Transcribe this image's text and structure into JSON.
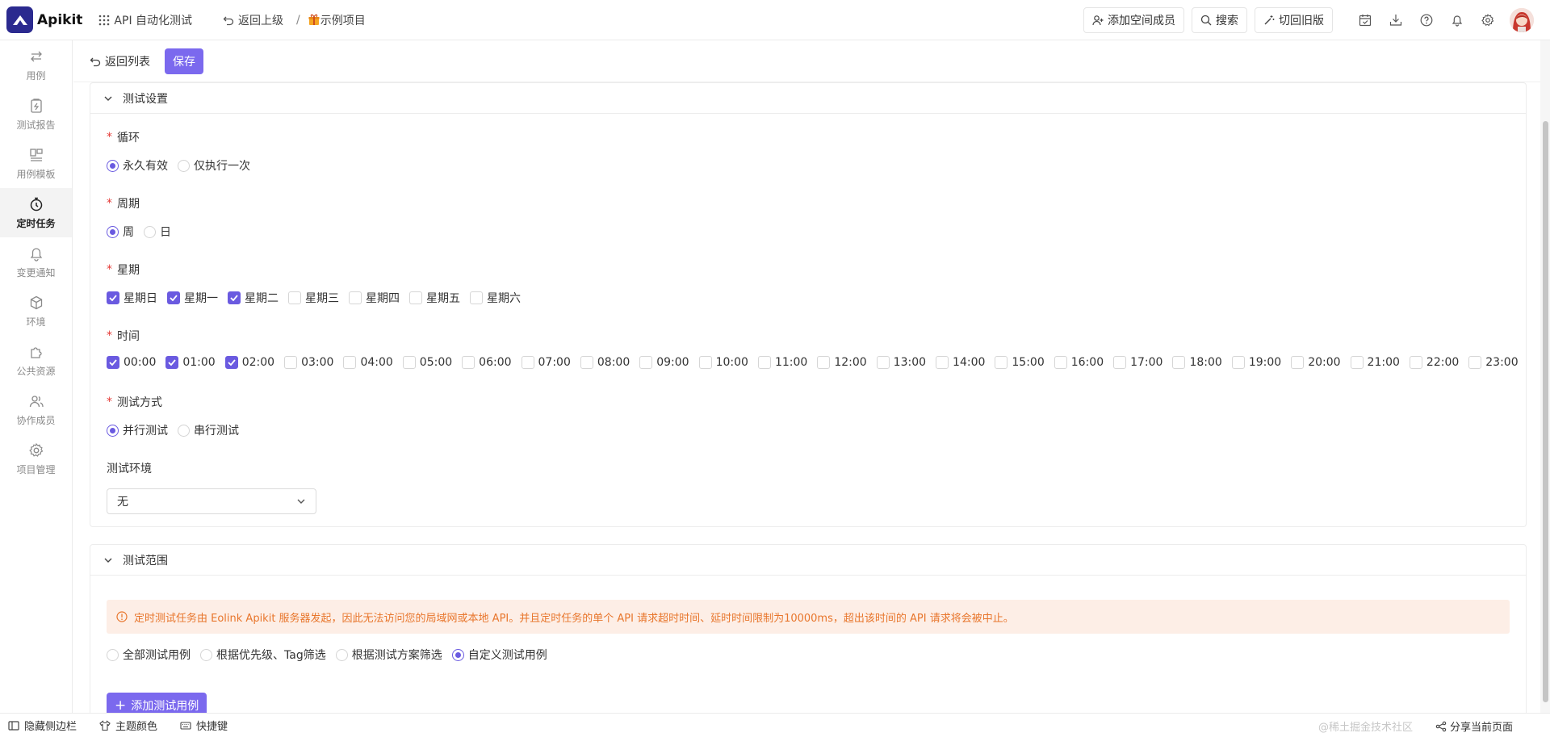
{
  "app": {
    "name": "Apikit"
  },
  "header": {
    "workspace": "API 自动化测试",
    "back_upper": "返回上级",
    "separator": "/",
    "project": "示例项目",
    "add_member": "添加空间成员",
    "search": "搜索",
    "old_version": "切回旧版"
  },
  "sidebar": {
    "items": [
      {
        "label": "用例",
        "icon": "swap-arrows-icon"
      },
      {
        "label": "测试报告",
        "icon": "report-icon"
      },
      {
        "label": "用例模板",
        "icon": "template-icon"
      },
      {
        "label": "定时任务",
        "icon": "timer-icon",
        "active": true
      },
      {
        "label": "变更通知",
        "icon": "bell-icon"
      },
      {
        "label": "环境",
        "icon": "cube-icon"
      },
      {
        "label": "公共资源",
        "icon": "puzzle-icon"
      },
      {
        "label": "协作成员",
        "icon": "users-icon"
      },
      {
        "label": "项目管理",
        "icon": "gear-icon"
      }
    ]
  },
  "actions": {
    "back_list": "返回列表",
    "save": "保存"
  },
  "settings": {
    "title": "测试设置",
    "loop": {
      "label": "循环",
      "options": [
        {
          "label": "永久有效",
          "checked": true
        },
        {
          "label": "仅执行一次",
          "checked": false
        }
      ]
    },
    "period": {
      "label": "周期",
      "options": [
        {
          "label": "周",
          "checked": true
        },
        {
          "label": "日",
          "checked": false
        }
      ]
    },
    "weekday": {
      "label": "星期",
      "options": [
        {
          "label": "星期日",
          "checked": true
        },
        {
          "label": "星期一",
          "checked": true
        },
        {
          "label": "星期二",
          "checked": true
        },
        {
          "label": "星期三",
          "checked": false
        },
        {
          "label": "星期四",
          "checked": false
        },
        {
          "label": "星期五",
          "checked": false
        },
        {
          "label": "星期六",
          "checked": false
        }
      ]
    },
    "time": {
      "label": "时间",
      "options": [
        {
          "label": "00:00",
          "checked": true
        },
        {
          "label": "01:00",
          "checked": true
        },
        {
          "label": "02:00",
          "checked": true
        },
        {
          "label": "03:00",
          "checked": false
        },
        {
          "label": "04:00",
          "checked": false
        },
        {
          "label": "05:00",
          "checked": false
        },
        {
          "label": "06:00",
          "checked": false
        },
        {
          "label": "07:00",
          "checked": false
        },
        {
          "label": "08:00",
          "checked": false
        },
        {
          "label": "09:00",
          "checked": false
        },
        {
          "label": "10:00",
          "checked": false
        },
        {
          "label": "11:00",
          "checked": false
        },
        {
          "label": "12:00",
          "checked": false
        },
        {
          "label": "13:00",
          "checked": false
        },
        {
          "label": "14:00",
          "checked": false
        },
        {
          "label": "15:00",
          "checked": false
        },
        {
          "label": "16:00",
          "checked": false
        },
        {
          "label": "17:00",
          "checked": false
        },
        {
          "label": "18:00",
          "checked": false
        },
        {
          "label": "19:00",
          "checked": false
        },
        {
          "label": "20:00",
          "checked": false
        },
        {
          "label": "21:00",
          "checked": false
        },
        {
          "label": "22:00",
          "checked": false
        },
        {
          "label": "23:00",
          "checked": false
        }
      ]
    },
    "mode": {
      "label": "测试方式",
      "options": [
        {
          "label": "并行测试",
          "checked": true
        },
        {
          "label": "串行测试",
          "checked": false
        }
      ]
    },
    "env": {
      "label": "测试环境",
      "value": "无"
    }
  },
  "scope": {
    "title": "测试范围",
    "notice": "定时测试任务由 Eolink Apikit 服务器发起，因此无法访问您的局域网或本地 API。并且定时任务的单个 API 请求超时时间、延时时间限制为10000ms，超出该时间的 API 请求将会被中止。",
    "options": [
      {
        "label": "全部测试用例",
        "checked": false
      },
      {
        "label": "根据优先级、Tag筛选",
        "checked": false
      },
      {
        "label": "根据测试方案筛选",
        "checked": false
      },
      {
        "label": "自定义测试用例",
        "checked": true
      }
    ],
    "add_case": "添加测试用例"
  },
  "footer": {
    "hide_sidebar": "隐藏侧边栏",
    "theme": "主题颜色",
    "shortcuts": "快捷键",
    "share": "分享当前页面",
    "watermark": "@稀土掘金技术社区"
  },
  "colors": {
    "accent": "#7b69ee",
    "logo_bg": "#2b2a8f",
    "notice_bg": "#fdeee6",
    "notice_text": "#e8762c"
  }
}
